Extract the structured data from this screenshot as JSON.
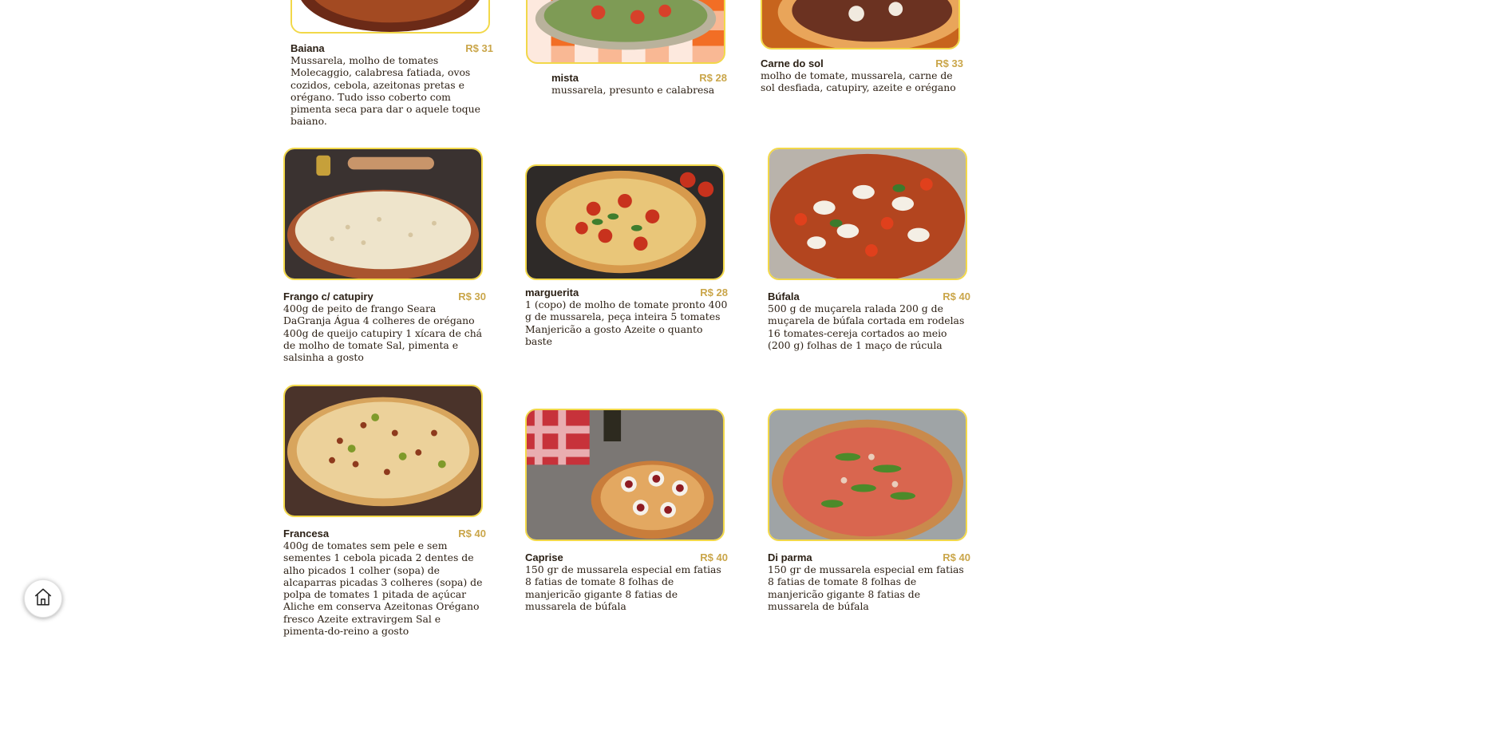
{
  "menu": {
    "items": [
      {
        "name": "Baiana",
        "price": "R$ 31",
        "desc": "Mussarela, molho de tomates Molecaggio, calabresa fatiada, ovos cozidos, cebola, azeitonas pretas e orégano. Tudo isso coberto com pimenta seca para dar o aquele toque baiano."
      },
      {
        "name": "mista",
        "price": "R$ 28",
        "desc": "mussarela, presunto e calabresa"
      },
      {
        "name": "Carne do sol",
        "price": "R$ 33",
        "desc": "molho de tomate, mussarela, carne de sol desfiada, catupiry, azeite e orégano"
      },
      {
        "name": "Frango c/ catupiry",
        "price": "R$ 30",
        "desc": "400g de peito de frango Seara DaGranja Água 4 colheres de orégano 400g de queijo catupiry 1 xícara de chá de molho de tomate Sal, pimenta e salsinha a gosto"
      },
      {
        "name": "marguerita",
        "price": "R$ 28",
        "desc": "1 (copo) de molho de tomate pronto 400 g de mussarela, peça inteira 5 tomates Manjericão a gosto Azeite o quanto baste"
      },
      {
        "name": "Búfala",
        "price": "R$ 40",
        "desc": "500 g de muçarela ralada 200 g de muçarela de búfala cortada em rodelas 16 tomates-cereja cortados ao meio (200 g) folhas de 1 maço de rúcula"
      },
      {
        "name": "Francesa",
        "price": "R$ 40",
        "desc": "400g de tomates sem pele e sem sementes 1 cebola picada 2 dentes de alho picados 1 colher (sopa) de alcaparras picadas 3 colheres (sopa) de polpa de tomates 1 pitada de açúcar Aliche em conserva Azeitonas Orégano fresco Azeite extravirgem Sal e pimenta-do-reino a gosto"
      },
      {
        "name": "Caprise",
        "price": "R$ 40",
        "desc": "150 gr de mussarela especial em fatias 8 fatias de tomate 8 folhas de manjericão gigante 8 fatias de mussarela de búfala"
      },
      {
        "name": "Di parma",
        "price": "R$ 40",
        "desc": "150 gr de mussarela especial em fatias 8 fatias de tomate 8 folhas de manjericão gigante 8 fatias de mussarela de búfala"
      }
    ]
  },
  "home_button": {
    "icon": "home-icon"
  },
  "colors": {
    "frame": "#f2d849",
    "price": "#caa64a",
    "text": "#2a1d12"
  }
}
